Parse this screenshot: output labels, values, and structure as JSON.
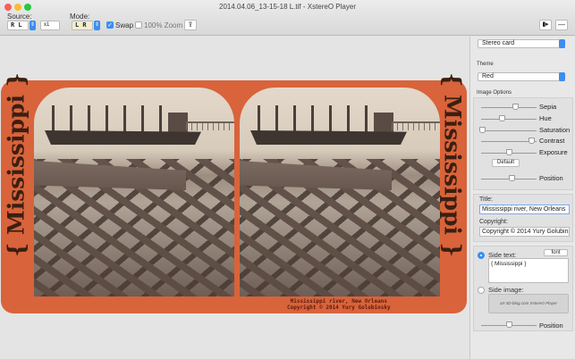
{
  "window": {
    "title": "2014.04.06_13-15-18 L.tif - XstereO Player"
  },
  "toolbar": {
    "source_label": "Source:",
    "source_value": "R L",
    "scale_value": "x1",
    "mode_label": "Mode:",
    "mode_value": "L R",
    "swap_label": "Swap",
    "swap_checked": true,
    "zoom_label": "100% Zoom",
    "zoom_checked": false
  },
  "card": {
    "side_text": "{ Mississippi }",
    "caption_title": "Mississippi river, New Orleans",
    "caption_copyright": "Copyright © 2014 Yury Golubinsky",
    "color": "#d9633a"
  },
  "panel": {
    "layout_value": "Stereo card",
    "theme_label": "Theme",
    "theme_value": "Red",
    "image_options_label": "Image Options",
    "sliders": [
      {
        "label": "Sepia",
        "value": 0.6
      },
      {
        "label": "Hue",
        "value": 0.35
      },
      {
        "label": "Saturation",
        "value": 0.0
      },
      {
        "label": "Contrast",
        "value": 0.9
      },
      {
        "label": "Exposure",
        "value": 0.5
      }
    ],
    "default_button": "Default",
    "position_label": "Position",
    "position_value": 0.55,
    "title_label": "Title:",
    "title_value": "Mississippi river, New Orleans",
    "copyright_label": "Copyright:",
    "copyright_value": "Copyright © 2014 Yury Golubinsky",
    "side_text_label": "Side text:",
    "font_button": "font",
    "side_text_value": "{ Mississippi }",
    "side_image_label": "Side image:",
    "side_image_logo": "art-3D-blog.com  XstereO Player",
    "side_position_label": "Position",
    "side_position_value": 0.5
  }
}
